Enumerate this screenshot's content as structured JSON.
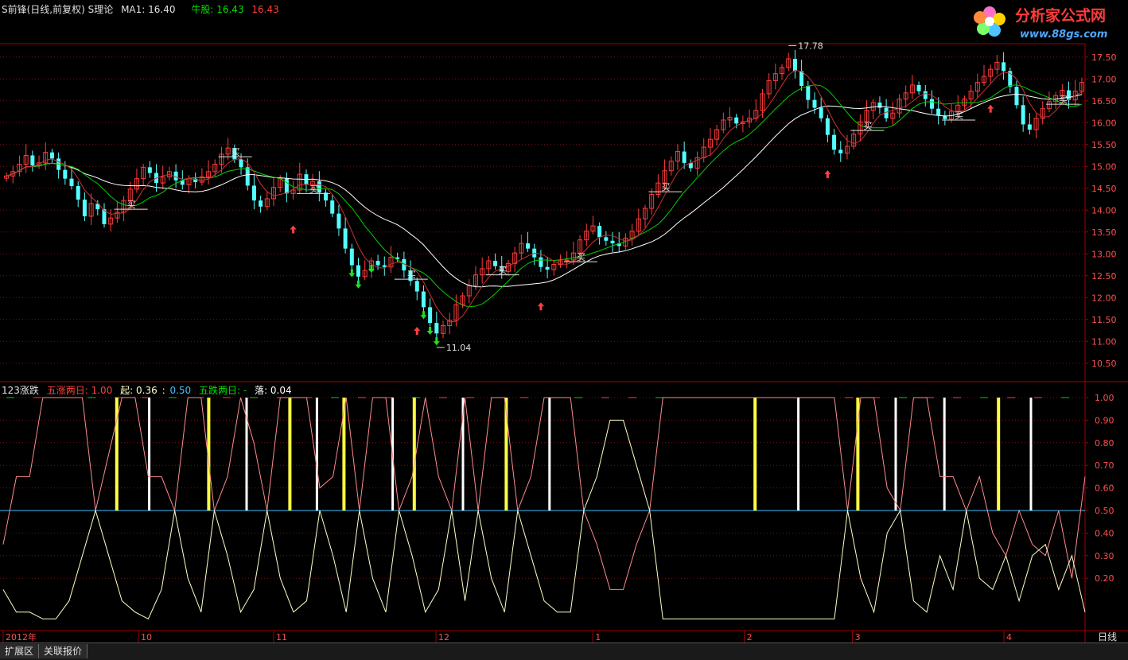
{
  "main_header": {
    "title": "S前锋(日线,前复权)",
    "indicator": "S理论",
    "ma1_label": "MA1:",
    "ma1_value": "16.40",
    "niugu_label": "牛股:",
    "niugu_value1": "16.43",
    "niugu_value2": "16.43"
  },
  "sub_header": {
    "title": "123涨跌",
    "wuzhang_label": "五涨两日:",
    "wuzhang_value": "1.00",
    "qi_label": "起:",
    "qi_value1": "0.36",
    "qi_value2": "0.50",
    "wudie_label": "五跌两日:",
    "wudie_value": "-",
    "luo_label": "落:",
    "luo_value": "0.04"
  },
  "logo": {
    "text": "分析家公式网",
    "url_text": "www.88gs.com"
  },
  "tabs": [
    "扩展区",
    "关联报价"
  ],
  "period_label": "日线",
  "colors": {
    "up": "#ff3c3c",
    "down": "#54ffff",
    "ma_white": "#ffffff",
    "ma_green": "#00d000",
    "ma_red": "#c83232",
    "grid": "#801010",
    "axis": "#a00000",
    "yellow": "#ffff40",
    "osc_a": "#ffffc8",
    "osc_b": "#ff8c8c",
    "mid_line": "#40c0ff"
  },
  "chart_data": [
    {
      "type": "candlestick",
      "yticks": [
        "17.50",
        "17.00",
        "16.50",
        "16.00",
        "15.50",
        "15.00",
        "14.50",
        "14.00",
        "13.50",
        "13.00",
        "12.50",
        "12.00",
        "11.50",
        "11.00",
        "10.50"
      ],
      "ylim": [
        10.35,
        17.75
      ],
      "xticks": [
        "2012年",
        "10",
        "11",
        "12",
        "1",
        "2",
        "3",
        "4"
      ],
      "annotations": {
        "high": "17.78",
        "low": "11.04",
        "buy_label": "买"
      },
      "close": [
        14.78,
        14.88,
        15.05,
        15.25,
        15.02,
        15.08,
        15.32,
        15.18,
        14.92,
        14.72,
        14.55,
        14.24,
        13.86,
        14.15,
        14.02,
        13.68,
        13.82,
        13.95,
        14.22,
        14.48,
        14.72,
        14.98,
        14.85,
        14.62,
        14.76,
        14.88,
        14.68,
        14.58,
        14.72,
        14.64,
        14.76,
        14.88,
        15.05,
        15.28,
        15.42,
        15.16,
        14.98,
        14.56,
        14.22,
        14.08,
        14.26,
        14.52,
        14.72,
        14.38,
        14.46,
        14.82,
        14.58,
        14.66,
        14.4,
        14.22,
        13.92,
        13.58,
        13.12,
        12.74,
        12.48,
        12.62,
        12.84,
        12.74,
        12.7,
        12.92,
        12.88,
        12.62,
        12.38,
        12.14,
        11.78,
        11.42,
        11.18,
        11.36,
        11.48,
        11.84,
        12.04,
        12.28,
        12.52,
        12.66,
        12.84,
        12.72,
        12.6,
        12.78,
        13.02,
        13.24,
        13.12,
        12.92,
        12.7,
        12.64,
        12.76,
        12.84,
        12.86,
        13.02,
        13.32,
        13.52,
        13.64,
        13.38,
        13.3,
        13.24,
        13.18,
        13.36,
        13.52,
        13.8,
        14.04,
        14.36,
        14.62,
        14.9,
        15.12,
        15.34,
        15.08,
        14.96,
        15.2,
        15.44,
        15.62,
        15.84,
        16.06,
        16.12,
        15.98,
        16.02,
        16.1,
        16.28,
        16.66,
        16.96,
        17.12,
        17.26,
        17.46,
        17.18,
        16.84,
        16.52,
        16.34,
        16.1,
        15.72,
        15.38,
        15.3,
        15.46,
        15.74,
        16.02,
        16.28,
        16.46,
        16.34,
        16.1,
        16.22,
        16.54,
        16.68,
        16.86,
        16.72,
        16.54,
        16.32,
        16.16,
        16.08,
        16.26,
        16.4,
        16.54,
        16.72,
        16.92,
        17.06,
        17.22,
        17.38,
        17.18,
        16.82,
        16.4,
        15.96,
        15.84,
        16.1,
        16.32,
        16.48,
        16.62,
        16.74,
        16.52,
        16.72,
        16.92
      ]
    },
    {
      "type": "line",
      "yticks": [
        "1.00",
        "0.90",
        "0.80",
        "0.70",
        "0.60",
        "0.50",
        "0.40",
        "0.30",
        "0.20"
      ],
      "ylim": [
        0.0,
        1.0
      ],
      "series": [
        {
          "values": [
            0.35,
            0.65,
            0.65,
            1.0,
            1.0,
            1.0,
            1.0,
            0.5,
            0.75,
            1.0,
            1.0,
            0.65,
            0.65,
            0.5,
            1.0,
            1.0,
            0.5,
            0.65,
            1.0,
            0.8,
            0.5,
            1.0,
            1.0,
            1.0,
            0.6,
            0.65,
            1.0,
            0.5,
            1.0,
            1.0,
            0.5,
            0.65,
            1.0,
            0.65,
            0.5,
            1.0,
            0.5,
            1.0,
            1.0,
            0.5,
            0.65,
            1.0,
            1.0,
            1.0,
            0.5,
            0.35,
            0.15,
            0.15,
            0.35,
            0.5,
            1.0,
            1.0,
            1.0,
            1.0,
            1.0,
            1.0,
            1.0,
            1.0,
            1.0,
            1.0,
            1.0,
            1.0,
            1.0,
            1.0,
            0.5,
            1.0,
            1.0,
            0.6,
            0.5,
            1.0,
            1.0,
            0.65,
            0.65,
            0.5,
            0.65,
            0.4,
            0.3,
            0.5,
            0.35,
            0.3,
            0.5,
            0.2,
            0.65
          ]
        },
        {
          "values": [
            0.15,
            0.05,
            0.05,
            0.02,
            0.02,
            0.1,
            0.3,
            0.5,
            0.3,
            0.1,
            0.05,
            0.02,
            0.15,
            0.5,
            0.2,
            0.05,
            0.5,
            0.3,
            0.05,
            0.15,
            0.5,
            0.2,
            0.05,
            0.1,
            0.5,
            0.3,
            0.05,
            0.5,
            0.2,
            0.05,
            0.5,
            0.3,
            0.05,
            0.15,
            0.5,
            0.1,
            0.5,
            0.2,
            0.05,
            0.5,
            0.3,
            0.1,
            0.05,
            0.05,
            0.5,
            0.65,
            0.9,
            0.9,
            0.7,
            0.5,
            0.02,
            0.02,
            0.02,
            0.02,
            0.02,
            0.02,
            0.02,
            0.02,
            0.02,
            0.02,
            0.02,
            0.02,
            0.02,
            0.02,
            0.5,
            0.2,
            0.05,
            0.4,
            0.5,
            0.1,
            0.05,
            0.3,
            0.15,
            0.5,
            0.2,
            0.15,
            0.3,
            0.1,
            0.3,
            0.35,
            0.15,
            0.3,
            0.05
          ]
        }
      ],
      "bars_yellow": [
        0.105,
        0.19,
        0.265,
        0.315,
        0.38,
        0.465,
        0.695,
        0.79,
        0.92
      ],
      "bars_white": [
        0.135,
        0.225,
        0.29,
        0.36,
        0.425,
        0.505,
        0.735,
        0.825,
        0.87,
        0.95
      ]
    }
  ]
}
